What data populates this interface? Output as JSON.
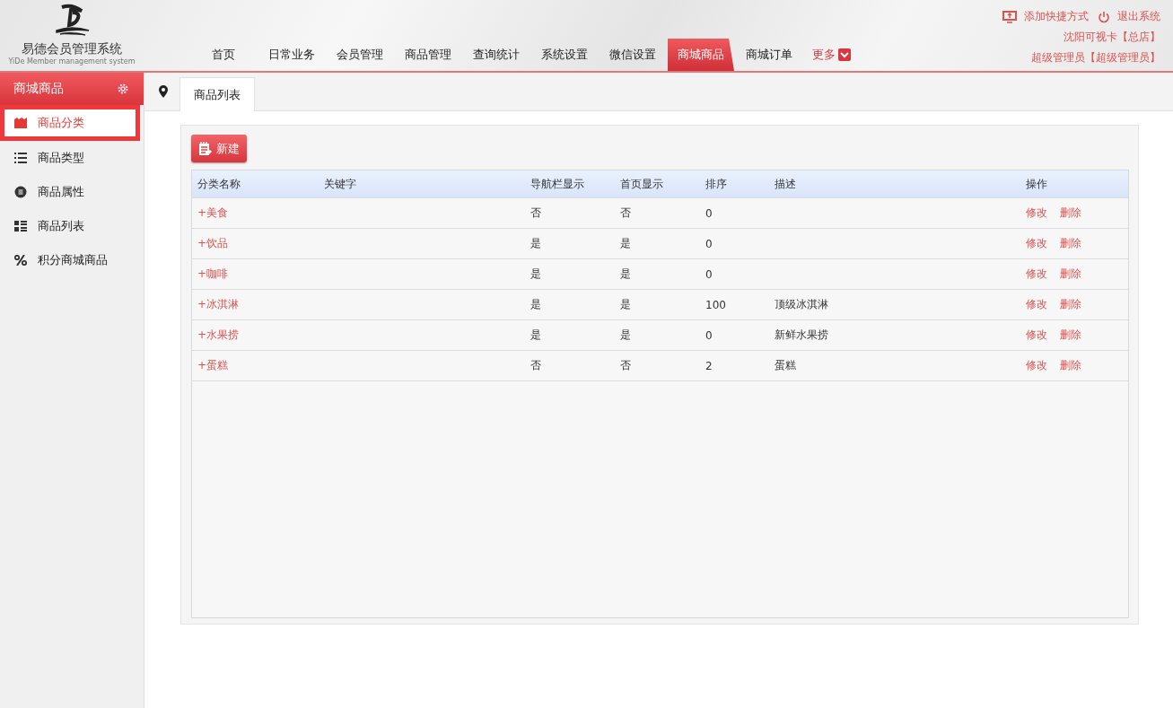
{
  "logo": {
    "title": "易德会员管理系统",
    "subtitle": "YiDe Member management system"
  },
  "nav": [
    {
      "label": "首页",
      "selected": false,
      "kind": "item"
    },
    {
      "label": "日常业务",
      "selected": false,
      "kind": "item"
    },
    {
      "label": "会员管理",
      "selected": false,
      "kind": "item"
    },
    {
      "label": "商品管理",
      "selected": false,
      "kind": "item"
    },
    {
      "label": "查询统计",
      "selected": false,
      "kind": "item"
    },
    {
      "label": "系统设置",
      "selected": false,
      "kind": "item"
    },
    {
      "label": "微信设置",
      "selected": false,
      "kind": "item"
    },
    {
      "label": "商城商品",
      "selected": true,
      "kind": "item"
    },
    {
      "label": "商城订单",
      "selected": false,
      "kind": "item"
    },
    {
      "label": "更多",
      "selected": false,
      "kind": "more"
    }
  ],
  "top_links": [
    {
      "label": "添加快捷方式",
      "kind": "shortcut"
    },
    {
      "label": "退出系统",
      "kind": "logout"
    }
  ],
  "store": "沈阳可视卡【总店】",
  "user": "超级管理员【超级管理员】",
  "sidebar": {
    "title": "商城商品",
    "items": [
      {
        "label": "商品分类",
        "selected": true,
        "kind": "category"
      },
      {
        "label": "商品类型",
        "selected": false,
        "kind": "type"
      },
      {
        "label": "商品属性",
        "selected": false,
        "kind": "attribute"
      },
      {
        "label": "商品列表",
        "selected": false,
        "kind": "list"
      },
      {
        "label": "积分商城商品",
        "selected": false,
        "kind": "percent"
      }
    ]
  },
  "tabs": [
    {
      "label": "商品列表",
      "selected": true
    }
  ],
  "new_button": "新建",
  "table": {
    "columns": [
      "分类名称",
      "关键字",
      "导航栏显示",
      "首页显示",
      "排序",
      "描述",
      "操作"
    ],
    "rows": [
      {
        "toggle": "+",
        "name": "美食",
        "keyword": "",
        "nav": "否",
        "home": "否",
        "sort": "0",
        "desc": "",
        "actions": [
          "修改",
          "删除"
        ]
      },
      {
        "toggle": "+",
        "name": "饮品",
        "keyword": "",
        "nav": "是",
        "home": "是",
        "sort": "0",
        "desc": "",
        "actions": [
          "修改",
          "删除"
        ]
      },
      {
        "toggle": "+",
        "name": "咖啡",
        "keyword": "",
        "nav": "是",
        "home": "是",
        "sort": "0",
        "desc": "",
        "actions": [
          "修改",
          "删除"
        ]
      },
      {
        "toggle": "+",
        "name": "冰淇淋",
        "keyword": "",
        "nav": "是",
        "home": "是",
        "sort": "100",
        "desc": "顶级冰淇淋",
        "actions": [
          "修改",
          "删除"
        ]
      },
      {
        "toggle": "+",
        "name": "水果捞",
        "keyword": "",
        "nav": "是",
        "home": "是",
        "sort": "0",
        "desc": "新鲜水果捞",
        "actions": [
          "修改",
          "删除"
        ]
      },
      {
        "toggle": "+",
        "name": "蛋糕",
        "keyword": "",
        "nav": "否",
        "home": "否",
        "sort": "2",
        "desc": "蛋糕",
        "actions": [
          "修改",
          "删除"
        ]
      }
    ]
  }
}
